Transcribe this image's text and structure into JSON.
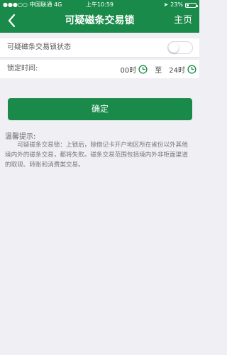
{
  "status_bar": {
    "carrier": "中国联通",
    "network": "4G",
    "time": "上午10:59",
    "battery": "23%",
    "battery_level": 0.23
  },
  "nav": {
    "title": "可疑磁条交易锁",
    "home_label": "主页",
    "icons": {
      "back": "chevron-left-icon"
    }
  },
  "lock_status": {
    "label": "可疑磁条交易锁状态",
    "enabled": false
  },
  "lock_time": {
    "label": "锁定时间:",
    "start": "00时",
    "separator": "至",
    "end": "24时",
    "icon": "clock-icon"
  },
  "confirm_label": "确定",
  "tips": {
    "title": "温馨提示:",
    "body": "可疑磁条交易锁：上锁后，除借记卡开户地区所在省份以外其他境内外的磁条交易，都将失败。磁条交易范围包括境内外非柜面渠道的取现、转账和消费类交易。"
  },
  "colors": {
    "brand": "#1a8a4a",
    "background": "#efeff4"
  }
}
